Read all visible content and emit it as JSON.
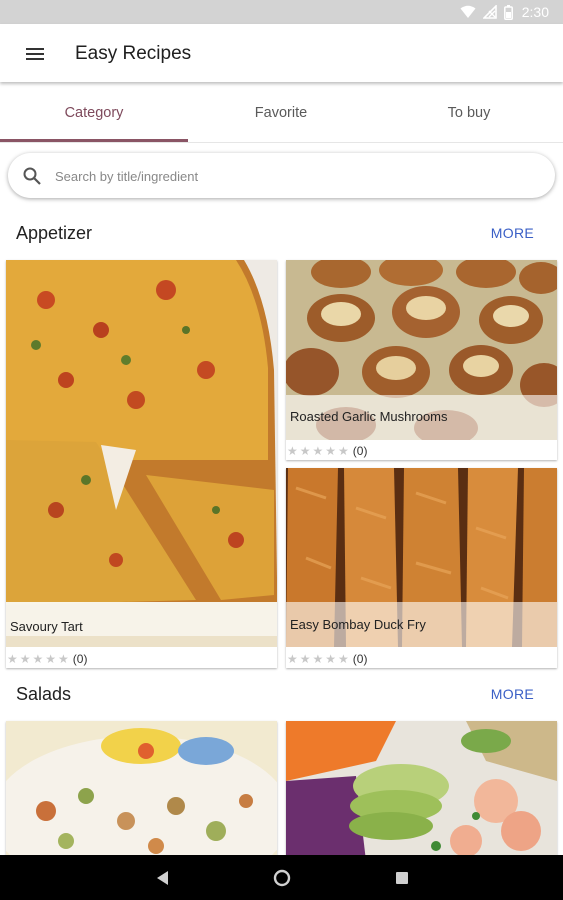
{
  "status_bar": {
    "time": "2:30",
    "icons": [
      "wifi-icon",
      "no-signal-icon",
      "battery-icon"
    ]
  },
  "app_bar": {
    "title": "Easy Recipes",
    "menu_icon": "hamburger-menu-icon"
  },
  "tabs": [
    {
      "label": "Category",
      "active": true
    },
    {
      "label": "Favorite",
      "active": false
    },
    {
      "label": "To buy",
      "active": false
    }
  ],
  "search": {
    "placeholder": "Search by title/ingredient",
    "value": ""
  },
  "sections": [
    {
      "title": "Appetizer",
      "more_label": "MORE",
      "recipes": [
        {
          "title": "Savoury Tart",
          "rating_count": "(0)"
        },
        {
          "title": "Roasted Garlic Mushrooms",
          "rating_count": "(0)"
        },
        {
          "title": "Easy Bombay Duck Fry",
          "rating_count": "(0)"
        }
      ]
    },
    {
      "title": "Salads",
      "more_label": "MORE",
      "recipes": [
        {
          "title": "",
          "rating_count": ""
        },
        {
          "title": "",
          "rating_count": ""
        }
      ]
    }
  ],
  "rating": {
    "stars_text": "★★★★★",
    "stars_value": 0,
    "stars_max": 5
  },
  "colors": {
    "accent": "#7e4a5c",
    "link": "#3a5fc6",
    "status_bar": "#d3d3d3",
    "nav_bar": "#000000"
  },
  "nav_bar": {
    "buttons": [
      "back-icon",
      "home-icon",
      "recents-icon"
    ]
  }
}
